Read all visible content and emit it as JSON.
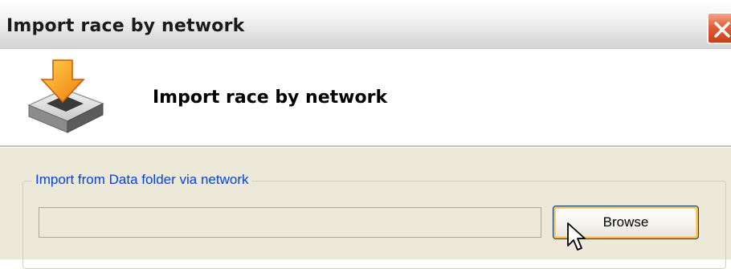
{
  "window": {
    "title": "Import race by network",
    "close_icon": "close-icon"
  },
  "header": {
    "icon": "import-tray-icon",
    "title": "Import race by network"
  },
  "import_group": {
    "label": "Import from Data folder via network",
    "path_value": "",
    "browse_label": "Browse"
  },
  "colors": {
    "group_label": "#0046d5",
    "panel_bg": "#ece9d8",
    "close_button": "#e0603a",
    "button_focus": "#f8b94a"
  }
}
